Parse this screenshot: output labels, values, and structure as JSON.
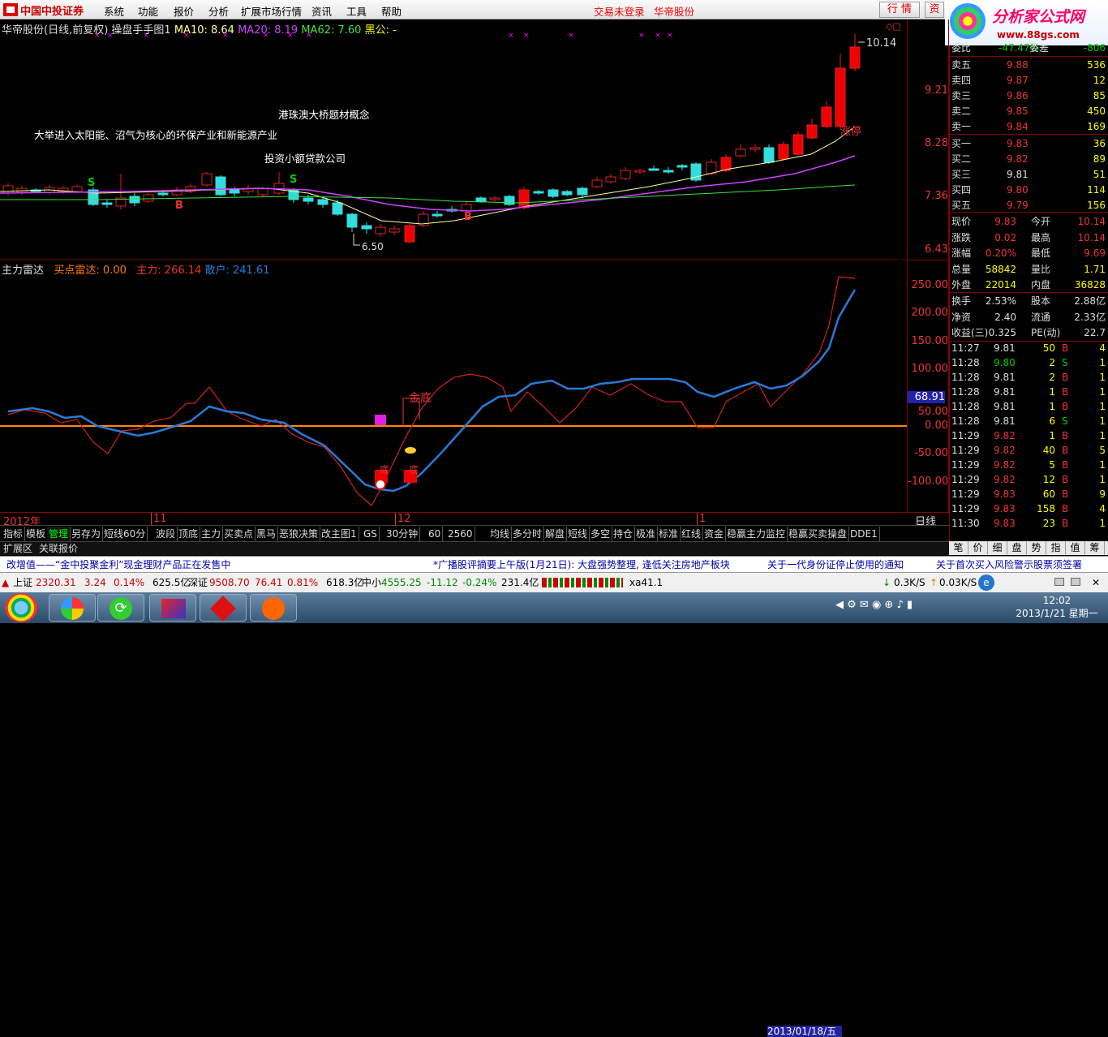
{
  "menubar": {
    "logo": "中国中投证券",
    "items": [
      "系统",
      "功能",
      "报价",
      "分析",
      "扩展市场行情",
      "资讯",
      "工具",
      "帮助"
    ],
    "status_red": "交易未登录",
    "stock": "华帝股份",
    "btn_quote": "行 情",
    "btn_trade": "资"
  },
  "brand": {
    "title": "分析家公式网",
    "url": "www.88gs.com"
  },
  "price_chart": {
    "title": "华帝股份(日线,前复权)",
    "indicator": "操盘手手图1",
    "ma10_label": "MA10: 8.64",
    "ma20_label": "MA20: 8.19",
    "ma62_label": "MA62: 7.60",
    "black_label": "黑公: -",
    "high_label": "10.14",
    "low_label": "6.50",
    "yticks": [
      "9.21",
      "8.28",
      "7.36",
      "6.43"
    ],
    "annotations": [
      "港珠澳大桥题材概念",
      "大举进入太阳能、沼气为核心的环保产业和新能源产业",
      "投资小额贷款公司"
    ],
    "signals": [
      "S",
      "B",
      "S",
      "B"
    ],
    "limit_label": "涨停"
  },
  "ind_chart": {
    "name": "主力雷达",
    "buy_label": "买点雷达: 0.00",
    "main_label": "主力: 266.14",
    "retail_label": "散户: 241.61",
    "yticks": [
      "250.00",
      "200.00",
      "150.00",
      "100.00",
      "50.00",
      "0.00",
      "-50.00",
      "-100.00"
    ],
    "current": "68.91",
    "labels": [
      "金底",
      "底",
      "底"
    ]
  },
  "time_axis": {
    "labels": [
      "2012年",
      "11",
      "12",
      "1"
    ],
    "date": "2013/01/18/五",
    "period": "日线"
  },
  "tabs": [
    "指标",
    "模板",
    "管理",
    "另存为",
    "短线60分",
    "波段",
    "顶底",
    "主力",
    "买卖点",
    "黑马",
    "恶狼决策",
    "改主图1",
    "GS",
    "30分钟",
    "60",
    "2560",
    "均线",
    "多分时",
    "解盘",
    "短线",
    "多空",
    "持仓",
    "极准",
    "标准",
    "红线",
    "资金",
    "稳赢主力监控",
    "稳赢买卖操盘",
    "DDE1"
  ],
  "subtabs": [
    "扩展区",
    "关联报价"
  ],
  "panel": {
    "weibi": "委比",
    "weibi_val": "-47.47%",
    "weicha": "委差",
    "weicha_val": "-806",
    "asks": [
      [
        "卖五",
        "9.88",
        "536"
      ],
      [
        "卖四",
        "9.87",
        "12"
      ],
      [
        "卖三",
        "9.86",
        "85"
      ],
      [
        "卖二",
        "9.85",
        "450"
      ],
      [
        "卖一",
        "9.84",
        "169"
      ]
    ],
    "bids": [
      [
        "买一",
        "9.83",
        "36"
      ],
      [
        "买二",
        "9.82",
        "89"
      ],
      [
        "买三",
        "9.81",
        "51"
      ],
      [
        "买四",
        "9.80",
        "114"
      ],
      [
        "买五",
        "9.79",
        "156"
      ]
    ],
    "stats": [
      [
        "现价",
        "9.83",
        "今开",
        "10.14"
      ],
      [
        "涨跌",
        "0.02",
        "最高",
        "10.14"
      ],
      [
        "涨幅",
        "0.20%",
        "最低",
        "9.69"
      ],
      [
        "总量",
        "58842",
        "量比",
        "1.71"
      ],
      [
        "外盘",
        "22014",
        "内盘",
        "36828"
      ]
    ],
    "fund": [
      [
        "换手",
        "2.53%",
        "股本",
        "2.88亿"
      ],
      [
        "净资",
        "2.40",
        "流通",
        "2.33亿"
      ],
      [
        "收益(三)",
        "0.325",
        "PE(动)",
        "22.7"
      ]
    ],
    "ticks": [
      [
        "11:27",
        "9.81",
        "50",
        "B",
        "4"
      ],
      [
        "11:28",
        "9.80",
        "2",
        "S",
        "1"
      ],
      [
        "11:28",
        "9.81",
        "2",
        "B",
        "1"
      ],
      [
        "11:28",
        "9.81",
        "1",
        "B",
        "1"
      ],
      [
        "11:28",
        "9.81",
        "1",
        "B",
        "1"
      ],
      [
        "11:28",
        "9.81",
        "6",
        "S",
        "1"
      ],
      [
        "11:29",
        "9.82",
        "1",
        "B",
        "1"
      ],
      [
        "11:29",
        "9.82",
        "40",
        "B",
        "5"
      ],
      [
        "11:29",
        "9.82",
        "5",
        "B",
        "1"
      ],
      [
        "11:29",
        "9.82",
        "12",
        "B",
        "1"
      ],
      [
        "11:29",
        "9.83",
        "60",
        "B",
        "9"
      ],
      [
        "11:29",
        "9.83",
        "158",
        "B",
        "4"
      ],
      [
        "11:30",
        "9.83",
        "23",
        "B",
        "1"
      ]
    ],
    "tabs": [
      "笔",
      "价",
      "细",
      "盘",
      "势",
      "指",
      "值",
      "筹"
    ]
  },
  "news": {
    "items": [
      "改增值——“金中投聚金利”现金理财产品正在发售中",
      "*广播股评摘要上午版(1月21日): 大盘强势整理, 逢低关注房地产板块",
      "关于一代身份证停止使用的通知",
      "关于首次买入风险警示股票须签署"
    ]
  },
  "status": {
    "sh_name": "上证",
    "sh_val": "2320.31",
    "sh_chg": "3.24",
    "sh_pct": "0.14%",
    "sh_amt": "625.5亿",
    "sz_name": "深证",
    "sz_val": "9508.70",
    "sz_chg": "76.41",
    "sz_pct": "0.81%",
    "sz_amt": "618.3亿",
    "zx_name": "中小",
    "zx_val": "4555.25",
    "zx_chg": "-11.12",
    "zx_pct": "-0.24%",
    "zx_amt": "231.4亿",
    "xa": "xa41.1",
    "down": "0.3K/S",
    "up": "0.03K/S"
  },
  "clock": {
    "time": "12:02",
    "date": "2013/1/21 星期一"
  }
}
